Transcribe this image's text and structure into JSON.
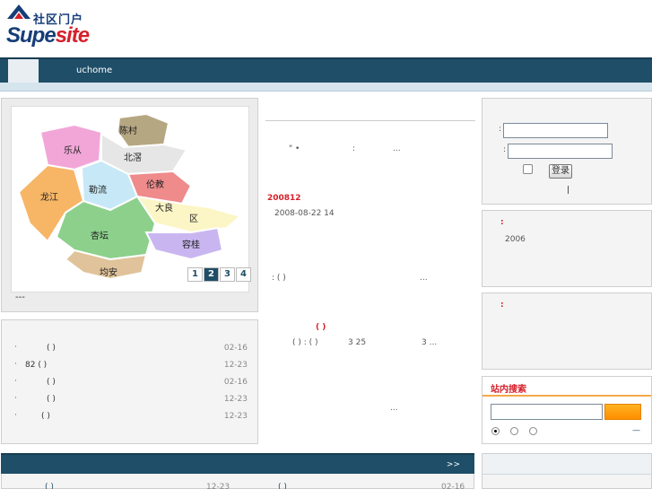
{
  "header": {
    "logo_cn": "社区门户",
    "logo_en_a": "Supe",
    "logo_en_b": "site",
    "nav_item": "uchome"
  },
  "slideshow": {
    "map_labels": [
      "陈村",
      "乐从",
      "北滘",
      "勒流",
      "伦教",
      "龙江",
      "大良",
      "区",
      "杏坛",
      "容桂",
      "均安"
    ],
    "pages": [
      "1",
      "2",
      "3",
      "4"
    ],
    "active_page": "2",
    "caption": "---"
  },
  "left_list": {
    "rows": [
      {
        "title": "( )",
        "date": "02-16"
      },
      {
        "title": "82      ( )",
        "date": "12-23"
      },
      {
        "title": "( )",
        "date": "02-16"
      },
      {
        "title": "( )",
        "date": "12-23"
      },
      {
        "title": "( )",
        "date": "12-23"
      }
    ],
    "bullet": "·"
  },
  "center": {
    "line1_a": "\" •",
    "line1_b": ":",
    "line1_c": "...",
    "headline": "200812",
    "date": "2008-08-22 14",
    "line2_a": ":   ( )",
    "line2_b": "...",
    "red_mark": "( )",
    "line3_a": "( )  :  ( )",
    "line3_b": "3 25",
    "line3_c": "3   ...",
    "line4": "..."
  },
  "login": {
    "label1": ":",
    "label2": ":",
    "button": "登录",
    "divider": "|"
  },
  "box1": {
    "label": ":",
    "text": "2006"
  },
  "box2": {
    "label": ":"
  },
  "search": {
    "title": "站内搜索",
    "dash": "—"
  },
  "bottom": {
    "more": ">>",
    "row_left": "( )",
    "date_left": "12-23",
    "row_right": "( )",
    "date_right": "02-16"
  },
  "colors": {
    "nav": "#1f4e68",
    "accent_red": "#d6202b",
    "search_orange": "#ff9a0f",
    "logo_blue": "#163d78"
  }
}
